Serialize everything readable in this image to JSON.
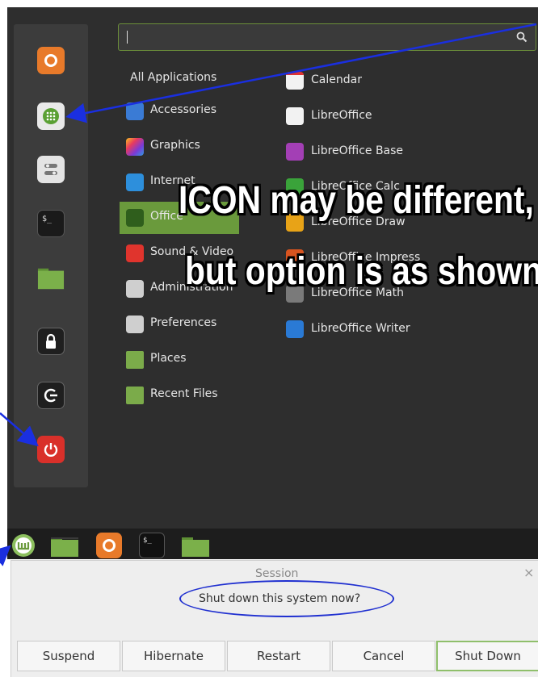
{
  "search": {
    "placeholder": ""
  },
  "favorites": [
    {
      "name": "firefox-icon"
    },
    {
      "name": "software-manager-icon"
    },
    {
      "name": "system-settings-icon"
    },
    {
      "name": "terminal-icon",
      "text": "$_"
    },
    {
      "name": "files-folder-icon"
    },
    {
      "name": "lock-screen-icon"
    },
    {
      "name": "logout-icon"
    },
    {
      "name": "power-icon"
    }
  ],
  "categories": {
    "all": "All Applications",
    "items": [
      {
        "label": "Accessories",
        "icon": "accessories-icon",
        "color": "#3a7bd5"
      },
      {
        "label": "Graphics",
        "icon": "graphics-icon",
        "color": "#d83a8a"
      },
      {
        "label": "Internet",
        "icon": "internet-icon",
        "color": "#2d8fdc"
      },
      {
        "label": "Office",
        "icon": "office-icon",
        "color": "#3e7a26"
      },
      {
        "label": "Sound & Video",
        "icon": "sound-video-icon",
        "color": "#e0342d"
      },
      {
        "label": "Administration",
        "icon": "administration-icon",
        "color": "#bbbbbb"
      },
      {
        "label": "Preferences",
        "icon": "preferences-icon",
        "color": "#bbbbbb"
      },
      {
        "label": "Places",
        "icon": "places-folder-icon",
        "color": "#7bab4a"
      },
      {
        "label": "Recent Files",
        "icon": "recent-files-icon",
        "color": "#7bab4a"
      }
    ]
  },
  "apps": [
    {
      "label": "Calendar",
      "icon": "calendar-icon",
      "color": "#f2f2f2"
    },
    {
      "label": "LibreOffice",
      "icon": "libreoffice-icon",
      "color": "#f2f2f2"
    },
    {
      "label": "LibreOffice Base",
      "icon": "libreoffice-base-icon",
      "color": "#a33fb5"
    },
    {
      "label": "LibreOffice Calc",
      "icon": "libreoffice-calc-icon",
      "color": "#3aa33a"
    },
    {
      "label": "LibreOffice Draw",
      "icon": "libreoffice-draw-icon",
      "color": "#e8a317"
    },
    {
      "label": "LibreOffice Impress",
      "icon": "libreoffice-impress-icon",
      "color": "#d9541f"
    },
    {
      "label": "LibreOffice Math",
      "icon": "libreoffice-math-icon",
      "color": "#7a7a7a"
    },
    {
      "label": "LibreOffice Writer",
      "icon": "libreoffice-writer-icon",
      "color": "#2a7ad5"
    }
  ],
  "panel": {
    "terminal_text": "$_"
  },
  "dialog": {
    "title": "Session",
    "close": "×",
    "message": "Shut down this system now?",
    "buttons": [
      "Suspend",
      "Hibernate",
      "Restart",
      "Cancel",
      "Shut Down"
    ]
  },
  "annotations": {
    "line1": "ICON may be different,",
    "line2": "but option is as shown"
  },
  "colors": {
    "accent": "#6a9a3c",
    "annotation_arrow": "#1a2fe0"
  }
}
